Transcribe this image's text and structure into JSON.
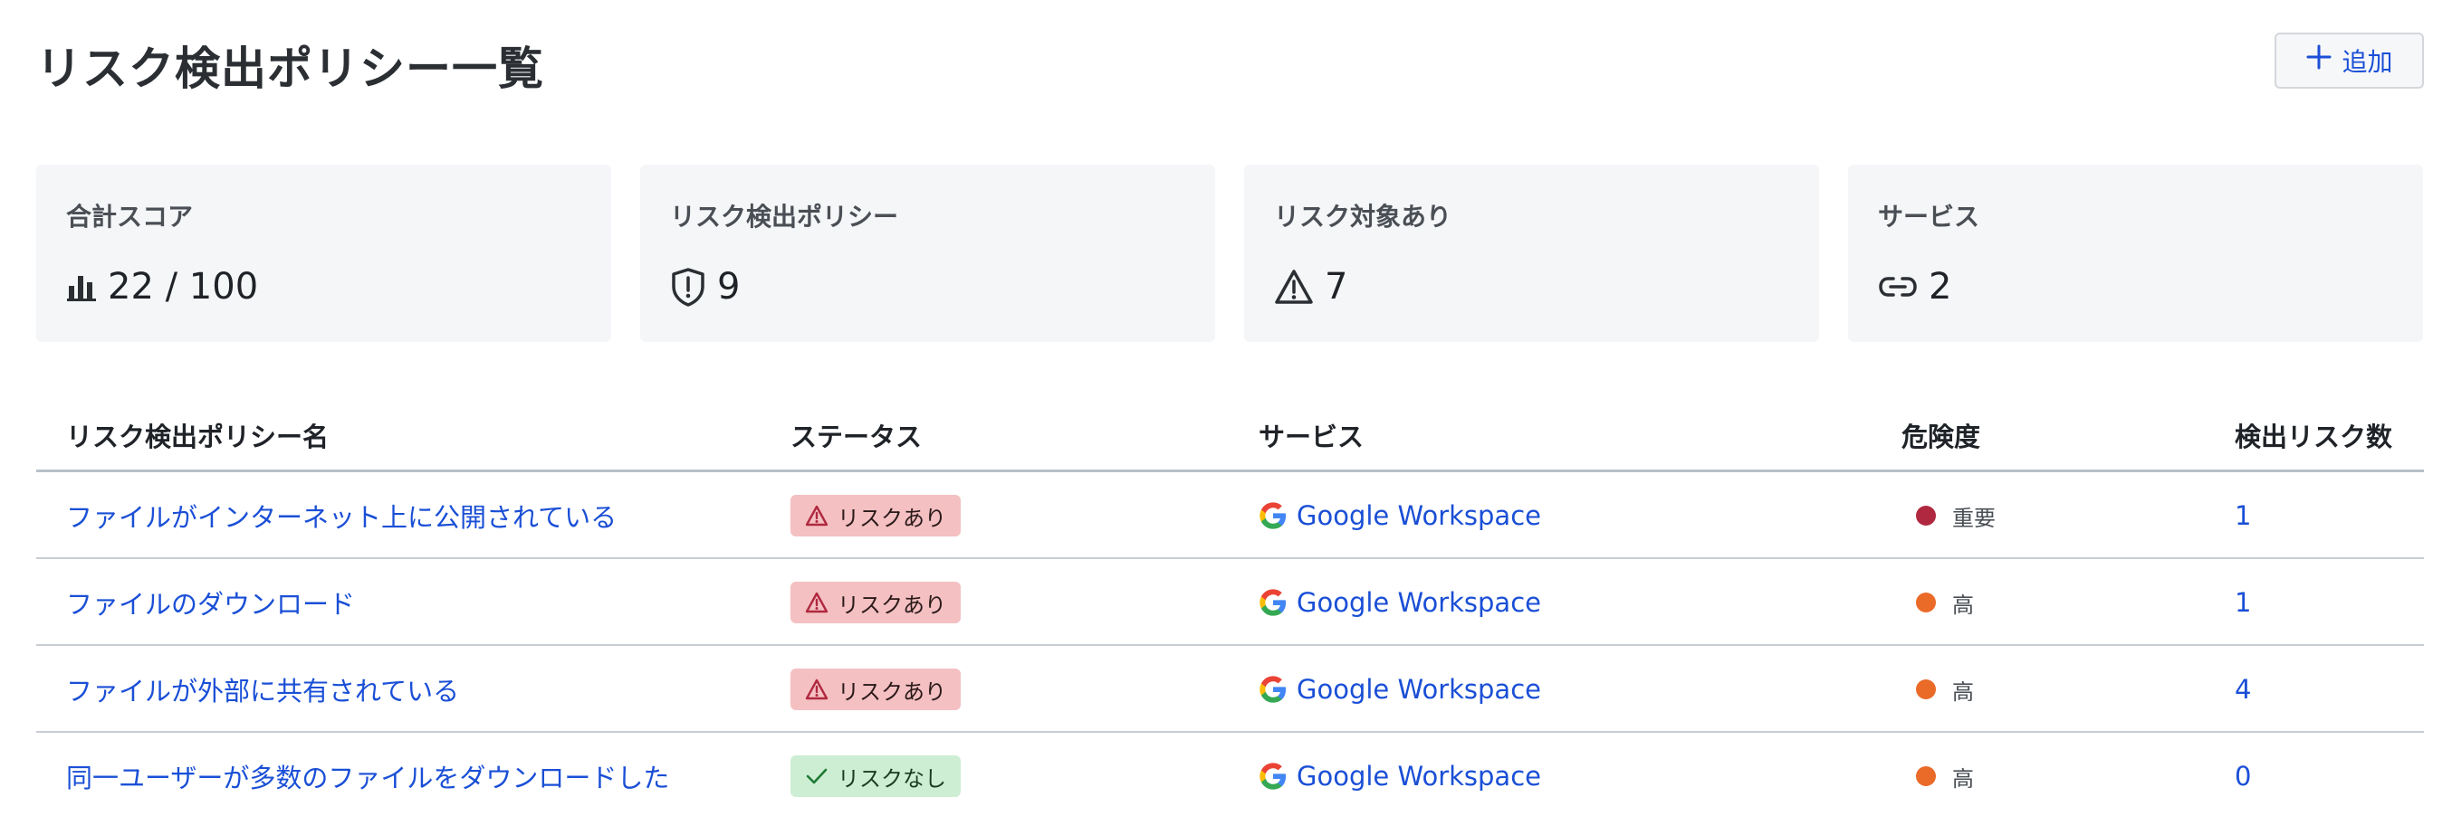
{
  "header": {
    "title": "リスク検出ポリシー一覧",
    "add_label": "追加"
  },
  "cards": [
    {
      "label": "合計スコア",
      "value": "22 / 100",
      "icon": "bar-chart-icon"
    },
    {
      "label": "リスク検出ポリシー",
      "value": "9",
      "icon": "shield-alert-icon"
    },
    {
      "label": "リスク対象あり",
      "value": "7",
      "icon": "warning-triangle-icon"
    },
    {
      "label": "サービス",
      "value": "2",
      "icon": "link-icon"
    }
  ],
  "table": {
    "columns": [
      "リスク検出ポリシー名",
      "ステータス",
      "サービス",
      "危険度",
      "検出リスク数"
    ],
    "rows": [
      {
        "name": "ファイルがインターネット上に公開されている",
        "status": "リスクあり",
        "status_type": "risk",
        "service": "Google Workspace",
        "severity": "重要",
        "severity_color": "#b0283f",
        "count": "1"
      },
      {
        "name": "ファイルのダウンロード",
        "status": "リスクあり",
        "status_type": "risk",
        "service": "Google Workspace",
        "severity": "高",
        "severity_color": "#ea6a28",
        "count": "1"
      },
      {
        "name": "ファイルが外部に共有されている",
        "status": "リスクあり",
        "status_type": "risk",
        "service": "Google Workspace",
        "severity": "高",
        "severity_color": "#ea6a28",
        "count": "4"
      },
      {
        "name": "同一ユーザーが多数のファイルをダウンロードした",
        "status": "リスクなし",
        "status_type": "ok",
        "service": "Google Workspace",
        "severity": "高",
        "severity_color": "#ea6a28",
        "count": "0"
      }
    ]
  },
  "colors": {
    "link": "#1a4fd6",
    "risk_badge": "#f4c0c2",
    "ok_badge": "#cdeed3",
    "card_bg": "#f5f6f8"
  }
}
